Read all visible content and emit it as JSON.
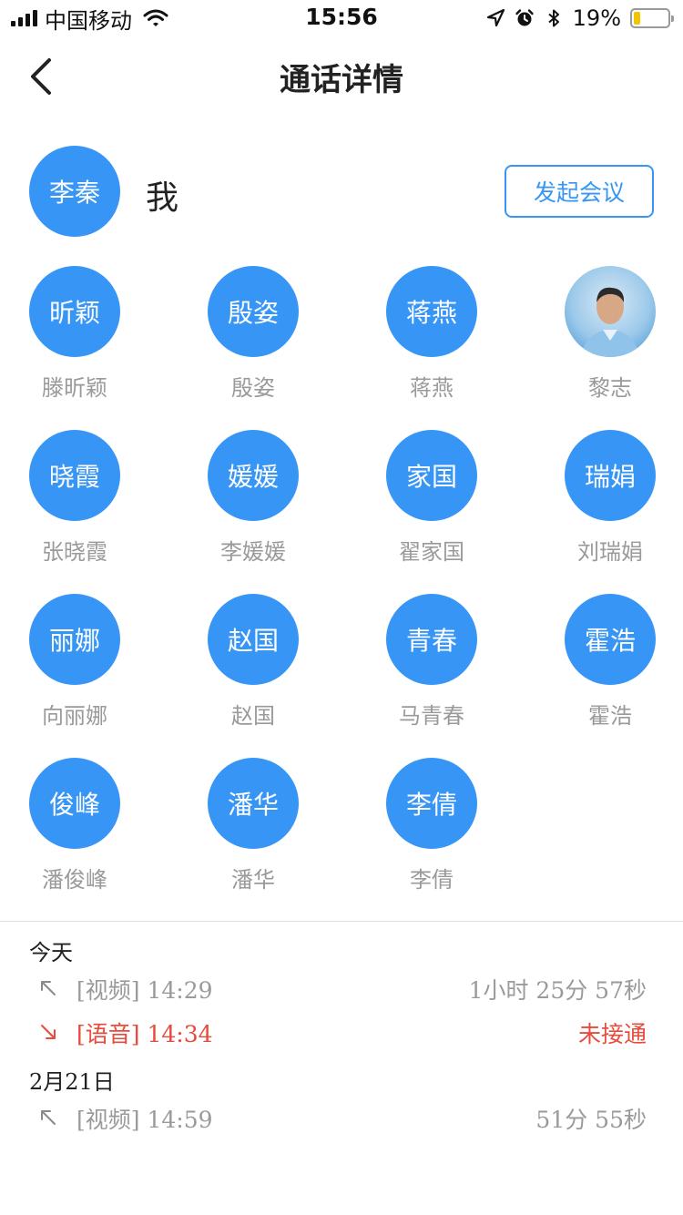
{
  "status_bar": {
    "carrier": "中国移动",
    "time": "15:56",
    "battery_percent": "19%",
    "battery_level": 0.19,
    "icons": [
      "signal-icon",
      "wifi-icon",
      "location-icon",
      "alarm-icon",
      "bluetooth-icon",
      "battery-icon"
    ]
  },
  "nav": {
    "title": "通话详情",
    "back_icon": "chevron-left-icon"
  },
  "me": {
    "avatar_text": "李秦",
    "label": "我",
    "meeting_button": "发起会议"
  },
  "colors": {
    "accent": "#3795f5",
    "missed": "#e84a3c",
    "muted": "#9a9a9a"
  },
  "members": [
    {
      "avatar": "昕颖",
      "name": "滕昕颖"
    },
    {
      "avatar": "殷姿",
      "name": "殷姿"
    },
    {
      "avatar": "蒋燕",
      "name": "蒋燕"
    },
    {
      "avatar": "",
      "name": "黎志",
      "photo": true
    },
    {
      "avatar": "晓霞",
      "name": "张晓霞"
    },
    {
      "avatar": "媛媛",
      "name": "李媛媛"
    },
    {
      "avatar": "家国",
      "name": "翟家国"
    },
    {
      "avatar": "瑞娟",
      "name": "刘瑞娟"
    },
    {
      "avatar": "丽娜",
      "name": "向丽娜"
    },
    {
      "avatar": "赵国",
      "name": "赵国"
    },
    {
      "avatar": "青春",
      "name": "马青春"
    },
    {
      "avatar": "霍浩",
      "name": "霍浩"
    },
    {
      "avatar": "俊峰",
      "name": "潘俊峰"
    },
    {
      "avatar": "潘华",
      "name": "潘华"
    },
    {
      "avatar": "李倩",
      "name": "李倩"
    }
  ],
  "call_log": [
    {
      "date": "今天",
      "calls": [
        {
          "type": "[视频] 14:29",
          "duration": "1小时 25分 57秒",
          "direction": "outgoing",
          "missed": false
        },
        {
          "type": "[语音] 14:34",
          "duration": "未接通",
          "direction": "incoming",
          "missed": true
        }
      ]
    },
    {
      "date": "2月21日",
      "calls": [
        {
          "type": "[视频] 14:59",
          "duration": "51分 55秒",
          "direction": "outgoing",
          "missed": false
        }
      ]
    }
  ]
}
